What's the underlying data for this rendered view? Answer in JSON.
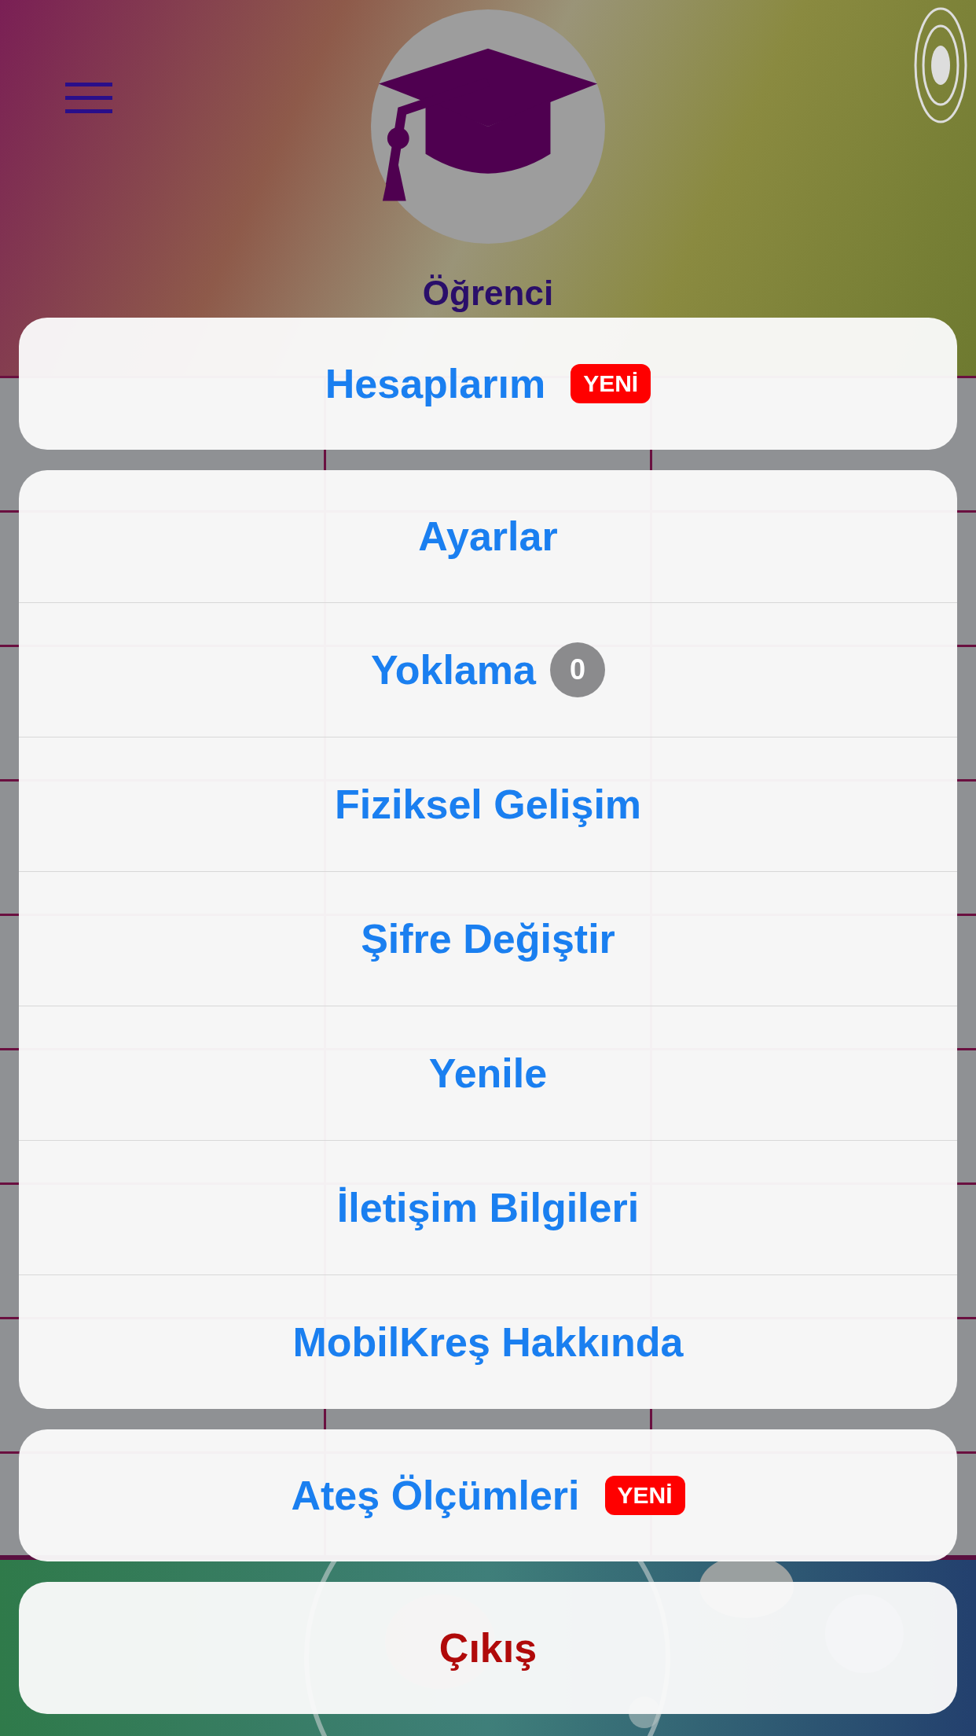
{
  "header": {
    "title": "Öğrenci"
  },
  "action_groups": [
    {
      "items": [
        {
          "label": "Hesaplarım",
          "kind": "default",
          "badge": {
            "kind": "new",
            "text": "YENİ"
          }
        }
      ]
    },
    {
      "items": [
        {
          "label": "Ayarlar",
          "kind": "default"
        },
        {
          "label": "Yoklama",
          "kind": "default",
          "badge": {
            "kind": "count",
            "text": "0"
          }
        },
        {
          "label": "Fiziksel Gelişim",
          "kind": "default"
        },
        {
          "label": "Şifre Değiştir",
          "kind": "default"
        },
        {
          "label": "Yenile",
          "kind": "default"
        },
        {
          "label": "İletişim Bilgileri",
          "kind": "default"
        },
        {
          "label": "MobilKreş Hakkında",
          "kind": "default"
        }
      ]
    },
    {
      "items": [
        {
          "label": "Ateş Ölçümleri",
          "kind": "default",
          "badge": {
            "kind": "new",
            "text": "YENİ"
          }
        }
      ]
    },
    {
      "items": [
        {
          "label": "Çıkış",
          "kind": "destructive"
        }
      ]
    }
  ]
}
